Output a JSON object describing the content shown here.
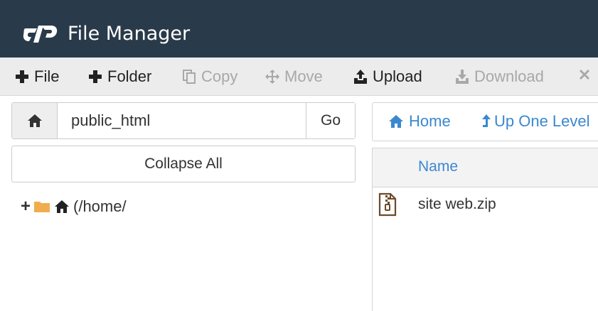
{
  "header": {
    "title": "File Manager",
    "logo_icon": "cpanel-logo-icon",
    "background": "#293a4a"
  },
  "toolbar": {
    "items": [
      {
        "label": "File",
        "icon": "plus-icon",
        "enabled": true
      },
      {
        "label": "Folder",
        "icon": "plus-icon",
        "enabled": true
      },
      {
        "label": "Copy",
        "icon": "copy-icon",
        "enabled": false
      },
      {
        "label": "Move",
        "icon": "move-icon",
        "enabled": false
      },
      {
        "label": "Upload",
        "icon": "upload-icon",
        "enabled": true
      },
      {
        "label": "Download",
        "icon": "download-icon",
        "enabled": false
      },
      {
        "label": "",
        "icon": "close-icon",
        "enabled": false
      }
    ]
  },
  "left_panel": {
    "path_value": "public_html",
    "go_label": "Go",
    "collapse_label": "Collapse All",
    "tree_root_label": "(/home/"
  },
  "right_panel": {
    "nav": {
      "home_label": "Home",
      "up_label": "Up One Level"
    },
    "table": {
      "column_name": "Name",
      "rows": [
        {
          "name": "site web.zip",
          "icon": "zip-file-icon"
        }
      ]
    }
  },
  "colors": {
    "link": "#3a88d0",
    "folder": "#f0ad4e",
    "toolbar_bg": "#ececec"
  }
}
